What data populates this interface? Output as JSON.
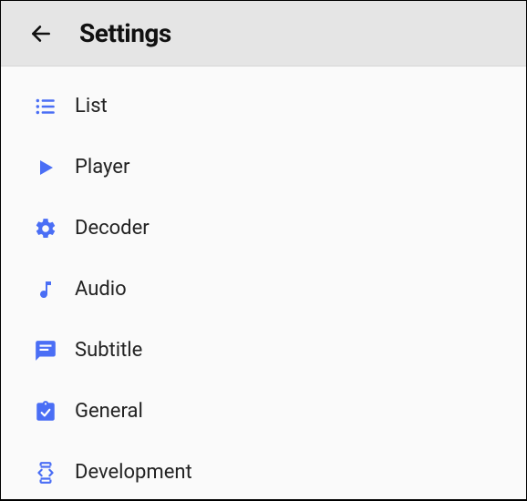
{
  "header": {
    "title": "Settings"
  },
  "accent": "#4a6ef5",
  "items": [
    {
      "icon": "list-icon",
      "label": "List"
    },
    {
      "icon": "play-icon",
      "label": "Player"
    },
    {
      "icon": "gear-icon",
      "label": "Decoder"
    },
    {
      "icon": "music-icon",
      "label": "Audio"
    },
    {
      "icon": "message-icon",
      "label": "Subtitle"
    },
    {
      "icon": "clipboard-icon",
      "label": "General"
    },
    {
      "icon": "dev-icon",
      "label": "Development"
    }
  ]
}
